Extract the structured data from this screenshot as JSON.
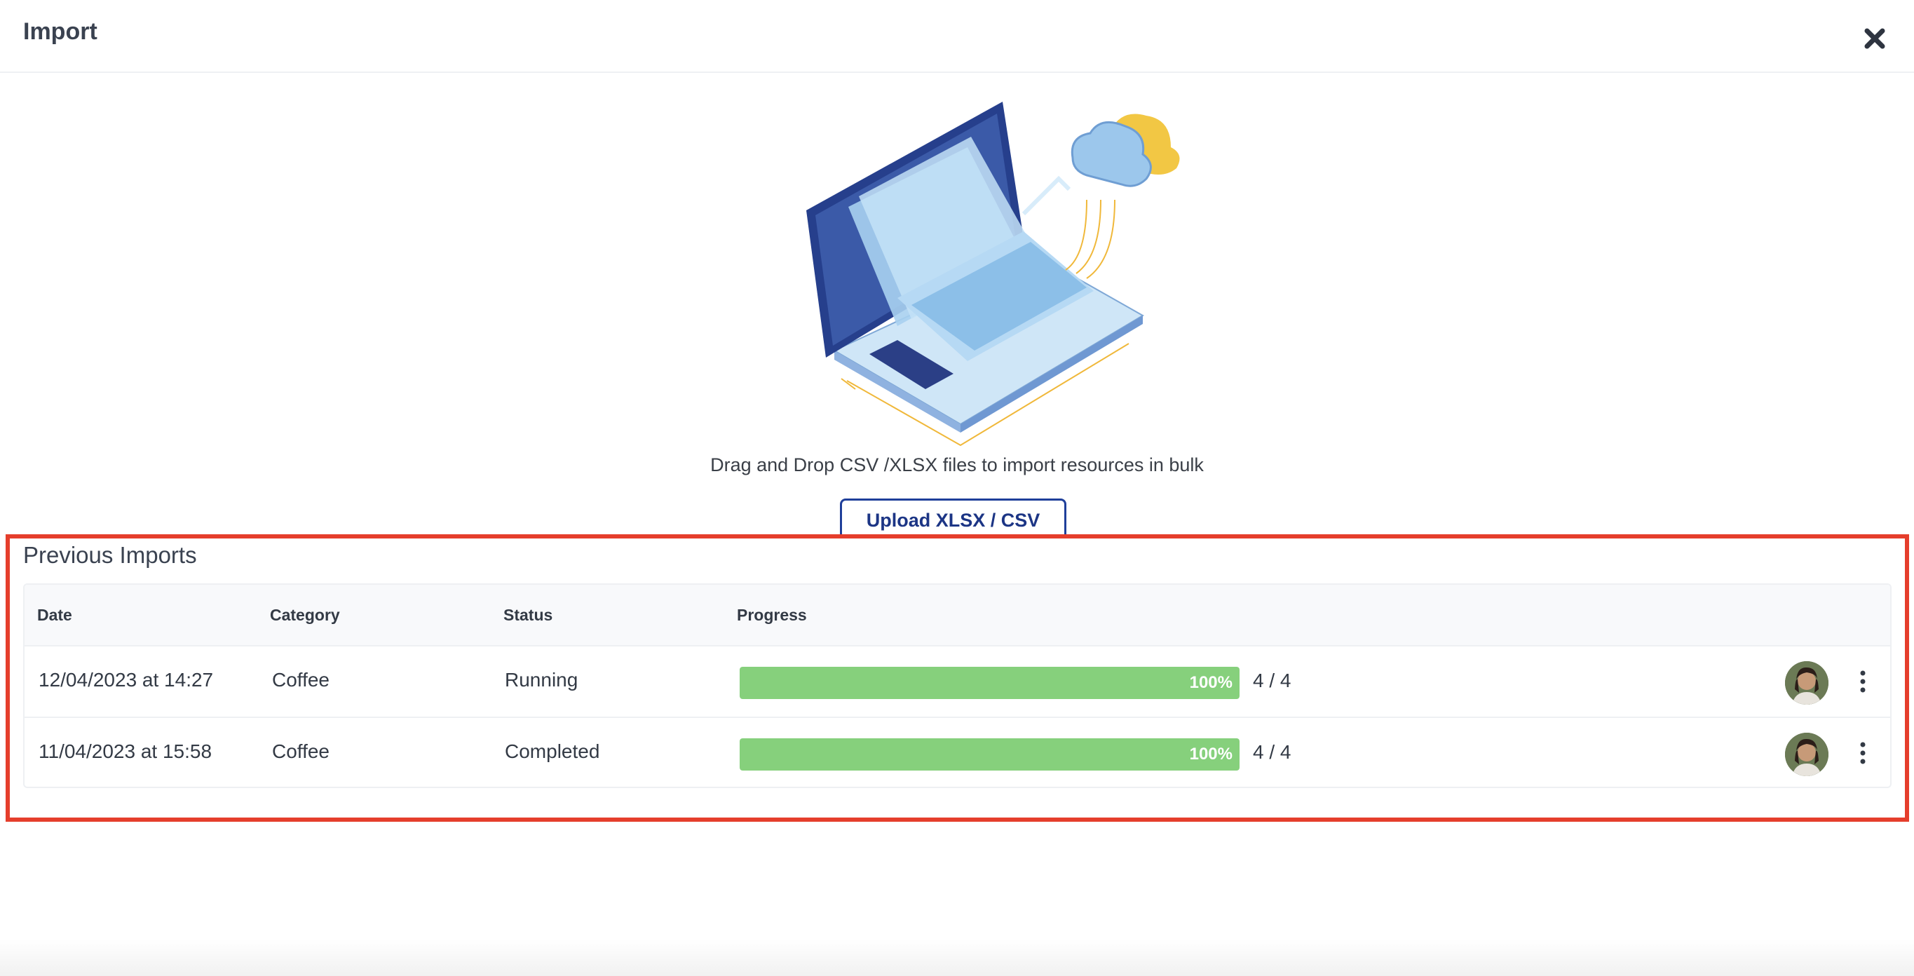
{
  "modal": {
    "title": "Import",
    "close_icon": "close-icon"
  },
  "upload": {
    "instructions": "Drag and Drop CSV /XLSX files to import resources in bulk",
    "button_label": "Upload XLSX / CSV"
  },
  "previous_imports": {
    "title": "Previous Imports",
    "columns": [
      "Date",
      "Category",
      "Status",
      "Progress"
    ],
    "rows": [
      {
        "date": "12/04/2023 at 14:27",
        "category": "Coffee",
        "status": "Running",
        "progress_percent": 100,
        "progress_label": "100%",
        "count": "4 / 4",
        "avatar_icon": "user-avatar",
        "menu_icon": "more-vertical-icon"
      },
      {
        "date": "11/04/2023 at 15:58",
        "category": "Coffee",
        "status": "Completed",
        "progress_percent": 100,
        "progress_label": "100%",
        "count": "4 / 4",
        "avatar_icon": "user-avatar",
        "menu_icon": "more-vertical-icon"
      }
    ]
  },
  "colors": {
    "accent_blue": "#1f3f9a",
    "progress_green": "#86d07c",
    "highlight_red": "#e53e2c"
  }
}
